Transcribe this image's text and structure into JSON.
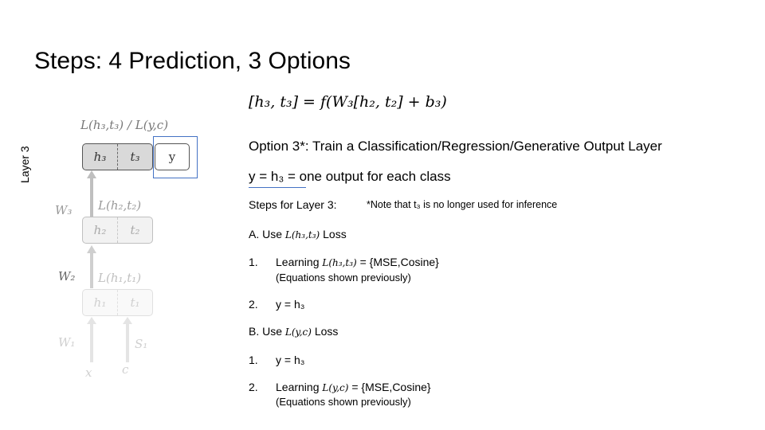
{
  "slide": {
    "title": "Steps: 4 Prediction, 3 Options",
    "equation": "[h₃, t₃] = f(W₃[h₂, t₂] + b₃)",
    "option_heading": "Option 3*: Train a Classification/Regression/Generative Output Layer",
    "y_definition": "y = h₃ = one output for each class",
    "steps_label": "Steps for Layer 3:",
    "note": "*Note that t₃ is no longer used for inference",
    "section_a": {
      "prefix": "A. Use",
      "math": "L(h₃,t₃)",
      "suffix": "Loss"
    },
    "a_items": [
      {
        "num": "1.",
        "prefix": "Learning",
        "math": "L(h₃,t₃)",
        "suffix": "= {MSE,Cosine}",
        "sub": "(Equations shown previously)"
      },
      {
        "num": "2.",
        "text": "y = h₃"
      }
    ],
    "section_b": {
      "prefix": "B. Use",
      "math": "L(y,c)",
      "suffix": "Loss"
    },
    "b_items": [
      {
        "num": "1.",
        "text": "y = h₃"
      },
      {
        "num": "2.",
        "prefix": "Learning",
        "math": "L(y,c)",
        "suffix": "= {MSE,Cosine}",
        "sub": "(Equations shown previously)"
      }
    ]
  },
  "diagram": {
    "layer_label": "Layer 3",
    "top_loss": "L(h₃,t₃) / L(y,c)",
    "l2_loss": "L(h₂,t₂)",
    "l1_loss": "L(h₁,t₁)",
    "w3": "W₃",
    "w2": "W₂",
    "w1": "W₁",
    "s1": "S₁",
    "x": "x",
    "c": "c",
    "box3": {
      "left": "h₃",
      "right": "t₃"
    },
    "box2": {
      "left": "h₂",
      "right": "t₂"
    },
    "box1": {
      "left": "h₁",
      "right": "t₁"
    },
    "y_box": "y",
    "colors": {
      "highlight": "#4472c4",
      "faded": "#c8c8c8",
      "mid": "#999999"
    }
  }
}
